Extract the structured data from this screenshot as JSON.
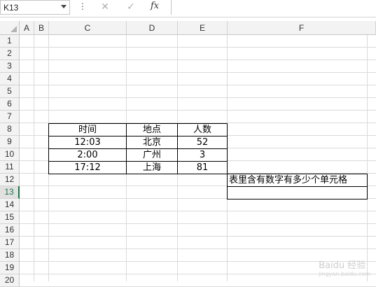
{
  "formula_bar": {
    "name_box": "K13",
    "dots": "⋮",
    "cancel": "✕",
    "enter": "✓",
    "fx": "fx",
    "formula": ""
  },
  "columns": [
    "A",
    "B",
    "C",
    "D",
    "E",
    "F"
  ],
  "rows": [
    "1",
    "2",
    "3",
    "4",
    "5",
    "6",
    "7",
    "8",
    "9",
    "10",
    "11",
    "12",
    "13",
    "14",
    "15",
    "16",
    "17",
    "18",
    "19",
    "20"
  ],
  "active_row": "13",
  "table": {
    "headers": [
      "时间",
      "地点",
      "人数"
    ],
    "rows": [
      [
        "12:03",
        "北京",
        "52"
      ],
      [
        "2:00",
        "广州",
        "3"
      ],
      [
        "17:12",
        "上海",
        "81"
      ]
    ]
  },
  "question_cell": "表里含有数字有多少个单元格",
  "answer_cell": "",
  "watermark": {
    "main": "Baidu 经验",
    "sub": "jingyan.baidu.com"
  },
  "colors": {
    "accent": "#217346",
    "grid": "#dadada",
    "header_bg": "#f3f3f3"
  }
}
